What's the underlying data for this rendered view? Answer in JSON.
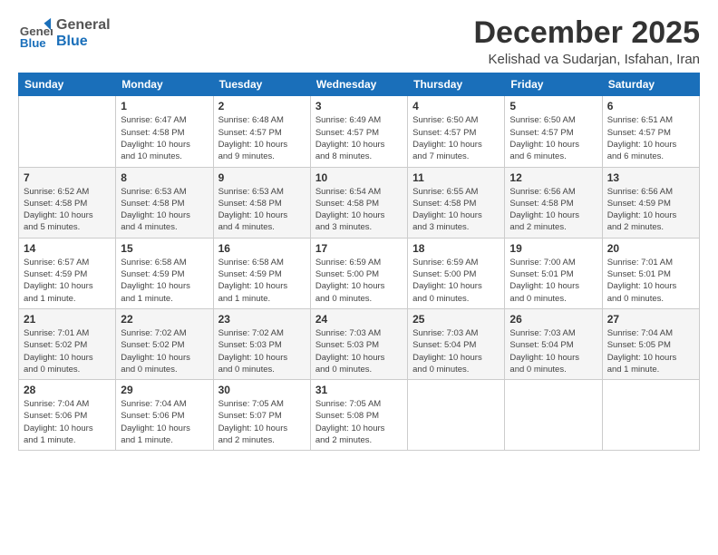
{
  "logo": {
    "general": "General",
    "blue": "Blue"
  },
  "header": {
    "month_year": "December 2025",
    "location": "Kelishad va Sudarjan, Isfahan, Iran"
  },
  "weekdays": [
    "Sunday",
    "Monday",
    "Tuesday",
    "Wednesday",
    "Thursday",
    "Friday",
    "Saturday"
  ],
  "weeks": [
    [
      {
        "day": "",
        "info": ""
      },
      {
        "day": "1",
        "info": "Sunrise: 6:47 AM\nSunset: 4:58 PM\nDaylight: 10 hours\nand 10 minutes."
      },
      {
        "day": "2",
        "info": "Sunrise: 6:48 AM\nSunset: 4:57 PM\nDaylight: 10 hours\nand 9 minutes."
      },
      {
        "day": "3",
        "info": "Sunrise: 6:49 AM\nSunset: 4:57 PM\nDaylight: 10 hours\nand 8 minutes."
      },
      {
        "day": "4",
        "info": "Sunrise: 6:50 AM\nSunset: 4:57 PM\nDaylight: 10 hours\nand 7 minutes."
      },
      {
        "day": "5",
        "info": "Sunrise: 6:50 AM\nSunset: 4:57 PM\nDaylight: 10 hours\nand 6 minutes."
      },
      {
        "day": "6",
        "info": "Sunrise: 6:51 AM\nSunset: 4:57 PM\nDaylight: 10 hours\nand 6 minutes."
      }
    ],
    [
      {
        "day": "7",
        "info": "Sunrise: 6:52 AM\nSunset: 4:58 PM\nDaylight: 10 hours\nand 5 minutes."
      },
      {
        "day": "8",
        "info": "Sunrise: 6:53 AM\nSunset: 4:58 PM\nDaylight: 10 hours\nand 4 minutes."
      },
      {
        "day": "9",
        "info": "Sunrise: 6:53 AM\nSunset: 4:58 PM\nDaylight: 10 hours\nand 4 minutes."
      },
      {
        "day": "10",
        "info": "Sunrise: 6:54 AM\nSunset: 4:58 PM\nDaylight: 10 hours\nand 3 minutes."
      },
      {
        "day": "11",
        "info": "Sunrise: 6:55 AM\nSunset: 4:58 PM\nDaylight: 10 hours\nand 3 minutes."
      },
      {
        "day": "12",
        "info": "Sunrise: 6:56 AM\nSunset: 4:58 PM\nDaylight: 10 hours\nand 2 minutes."
      },
      {
        "day": "13",
        "info": "Sunrise: 6:56 AM\nSunset: 4:59 PM\nDaylight: 10 hours\nand 2 minutes."
      }
    ],
    [
      {
        "day": "14",
        "info": "Sunrise: 6:57 AM\nSunset: 4:59 PM\nDaylight: 10 hours\nand 1 minute."
      },
      {
        "day": "15",
        "info": "Sunrise: 6:58 AM\nSunset: 4:59 PM\nDaylight: 10 hours\nand 1 minute."
      },
      {
        "day": "16",
        "info": "Sunrise: 6:58 AM\nSunset: 4:59 PM\nDaylight: 10 hours\nand 1 minute."
      },
      {
        "day": "17",
        "info": "Sunrise: 6:59 AM\nSunset: 5:00 PM\nDaylight: 10 hours\nand 0 minutes."
      },
      {
        "day": "18",
        "info": "Sunrise: 6:59 AM\nSunset: 5:00 PM\nDaylight: 10 hours\nand 0 minutes."
      },
      {
        "day": "19",
        "info": "Sunrise: 7:00 AM\nSunset: 5:01 PM\nDaylight: 10 hours\nand 0 minutes."
      },
      {
        "day": "20",
        "info": "Sunrise: 7:01 AM\nSunset: 5:01 PM\nDaylight: 10 hours\nand 0 minutes."
      }
    ],
    [
      {
        "day": "21",
        "info": "Sunrise: 7:01 AM\nSunset: 5:02 PM\nDaylight: 10 hours\nand 0 minutes."
      },
      {
        "day": "22",
        "info": "Sunrise: 7:02 AM\nSunset: 5:02 PM\nDaylight: 10 hours\nand 0 minutes."
      },
      {
        "day": "23",
        "info": "Sunrise: 7:02 AM\nSunset: 5:03 PM\nDaylight: 10 hours\nand 0 minutes."
      },
      {
        "day": "24",
        "info": "Sunrise: 7:03 AM\nSunset: 5:03 PM\nDaylight: 10 hours\nand 0 minutes."
      },
      {
        "day": "25",
        "info": "Sunrise: 7:03 AM\nSunset: 5:04 PM\nDaylight: 10 hours\nand 0 minutes."
      },
      {
        "day": "26",
        "info": "Sunrise: 7:03 AM\nSunset: 5:04 PM\nDaylight: 10 hours\nand 0 minutes."
      },
      {
        "day": "27",
        "info": "Sunrise: 7:04 AM\nSunset: 5:05 PM\nDaylight: 10 hours\nand 1 minute."
      }
    ],
    [
      {
        "day": "28",
        "info": "Sunrise: 7:04 AM\nSunset: 5:06 PM\nDaylight: 10 hours\nand 1 minute."
      },
      {
        "day": "29",
        "info": "Sunrise: 7:04 AM\nSunset: 5:06 PM\nDaylight: 10 hours\nand 1 minute."
      },
      {
        "day": "30",
        "info": "Sunrise: 7:05 AM\nSunset: 5:07 PM\nDaylight: 10 hours\nand 2 minutes."
      },
      {
        "day": "31",
        "info": "Sunrise: 7:05 AM\nSunset: 5:08 PM\nDaylight: 10 hours\nand 2 minutes."
      },
      {
        "day": "",
        "info": ""
      },
      {
        "day": "",
        "info": ""
      },
      {
        "day": "",
        "info": ""
      }
    ]
  ]
}
